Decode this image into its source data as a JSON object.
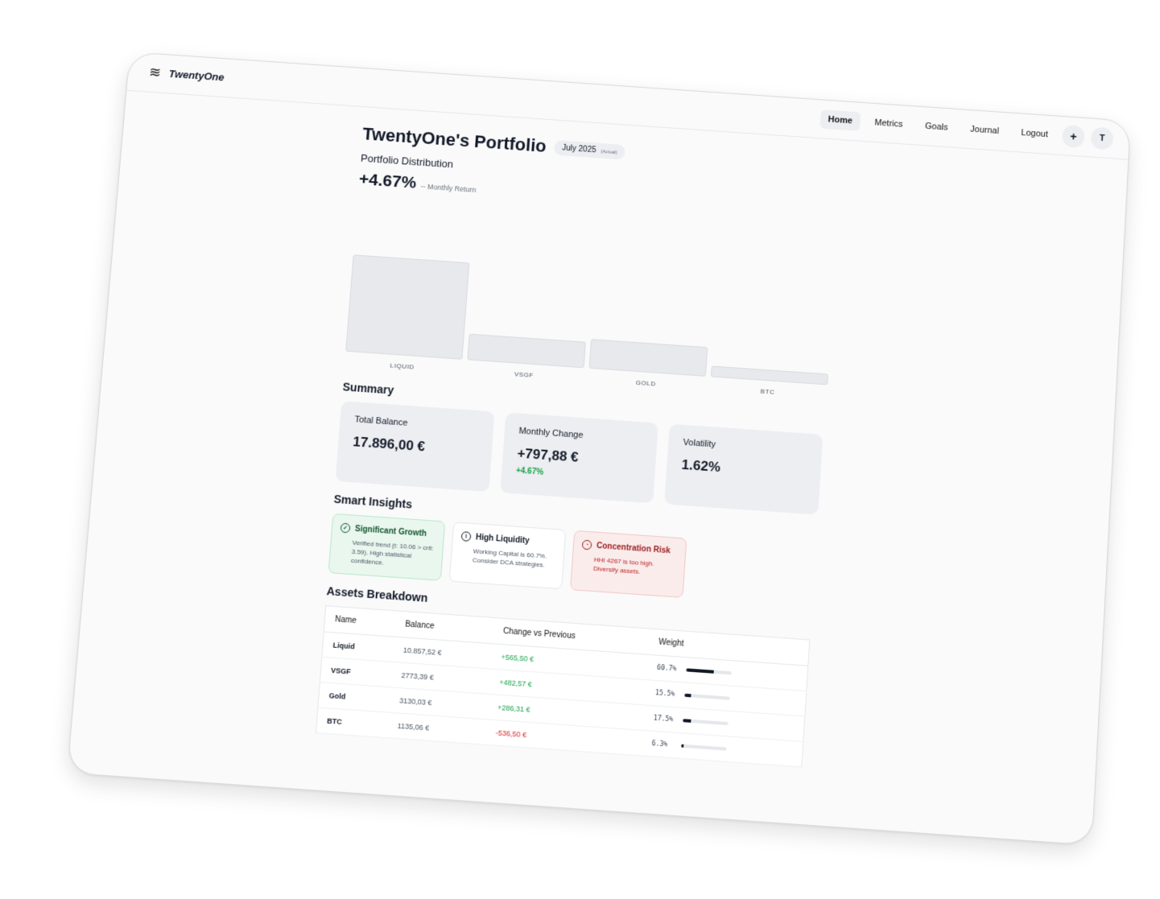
{
  "app": {
    "name": "TwentyOne"
  },
  "nav": {
    "items": [
      {
        "label": "Home",
        "active": true
      },
      {
        "label": "Metrics"
      },
      {
        "label": "Goals"
      },
      {
        "label": "Journal"
      },
      {
        "label": "Logout"
      }
    ],
    "add_label": "+",
    "avatar_initial": "T"
  },
  "header": {
    "title": "TwentyOne's Portfolio",
    "period": "July 2025",
    "period_note": "(Actual)"
  },
  "distribution": {
    "label": "Portfolio Distribution",
    "return_value": "+4.67%",
    "return_note": "-- Monthly Return"
  },
  "chart_data": {
    "type": "bar",
    "categories": [
      "LIQUID",
      "VSGF",
      "GOLD",
      "BTC"
    ],
    "values": [
      60.7,
      15.5,
      17.5,
      6.3
    ]
  },
  "summary": {
    "heading": "Summary",
    "cards": [
      {
        "label": "Total Balance",
        "value": "17.896,00 €"
      },
      {
        "label": "Monthly Change",
        "value": "+797,88 €",
        "sub": "+4.67%"
      },
      {
        "label": "Volatility",
        "value": "1.62%"
      }
    ]
  },
  "insights": {
    "heading": "Smart Insights",
    "items": [
      {
        "title": "Significant Growth",
        "text": "Verified trend (t: 10.06 > crit: 3.59). High statistical confidence.",
        "tone": "green",
        "icon": "check-circle-icon"
      },
      {
        "title": "High Liquidity",
        "text": "Working Capital is 60.7%. Consider DCA strategies.",
        "tone": "neutral",
        "icon": "info-icon"
      },
      {
        "title": "Concentration Risk",
        "text": "HHI 4267 is too high. Diversify assets.",
        "tone": "red",
        "icon": "pie-chart-icon"
      }
    ]
  },
  "assets": {
    "heading": "Assets Breakdown",
    "columns": [
      "Name",
      "Balance",
      "Change vs Previous",
      "Weight"
    ],
    "rows": [
      {
        "name": "Liquid",
        "balance": "10.857,52 €",
        "change": "+565,50 €",
        "weight": "60.7%",
        "weight_value": 60.7
      },
      {
        "name": "VSGF",
        "balance": "2773,39 €",
        "change": "+482,57 €",
        "weight": "15.5%",
        "weight_value": 15.5
      },
      {
        "name": "Gold",
        "balance": "3130,03 €",
        "change": "+286,31 €",
        "weight": "17.5%",
        "weight_value": 17.5
      },
      {
        "name": "BTC",
        "balance": "1135,06 €",
        "change": "-536,50 €",
        "weight": "6.3%",
        "weight_value": 6.3
      }
    ]
  },
  "colors": {
    "positive": "#16a34a",
    "negative": "#dc2626"
  }
}
